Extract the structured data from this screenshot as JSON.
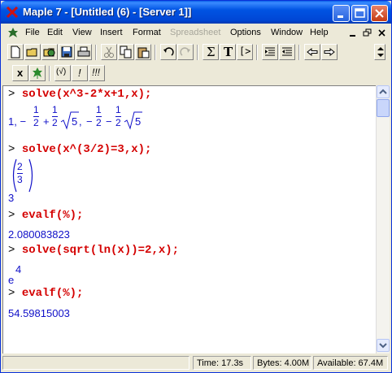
{
  "window": {
    "title": "Maple 7  - [Untitled (6) - [Server 1]]"
  },
  "menu": {
    "items": [
      {
        "label": "File",
        "enabled": true
      },
      {
        "label": "Edit",
        "enabled": true
      },
      {
        "label": "View",
        "enabled": true
      },
      {
        "label": "Insert",
        "enabled": true
      },
      {
        "label": "Format",
        "enabled": true
      },
      {
        "label": "Spreadsheet",
        "enabled": false
      },
      {
        "label": "Options",
        "enabled": true
      },
      {
        "label": "Window",
        "enabled": true
      },
      {
        "label": "Help",
        "enabled": true
      }
    ]
  },
  "toolbar": {
    "text_mode_label": "T",
    "sum_label": "Σ",
    "exec_label": "[>",
    "toggle_x_label": "x",
    "eval_label": "(√)",
    "bang_label": "!",
    "bangs_label": "!!!"
  },
  "worksheet": {
    "prompt": ">",
    "cmd1": "solve(x^3-2*x+1,x);",
    "out1_lead": "1, −",
    "out1_comma": ",",
    "out1_sqrt": "5",
    "frac_num": "1",
    "frac_den": "2",
    "op_plus": "+",
    "op_minus": "−",
    "cmd2": "solve(x^(3/2)=3,x);",
    "out2_num": "2",
    "out2_den": "3",
    "out2_base": "3",
    "cmd3": "evalf(%);",
    "out3": "2.080083823",
    "cmd4": "solve(sqrt(ln(x))=2,x);",
    "out4_base": "e",
    "out4_exp": "4",
    "cmd5": "evalf(%);",
    "out5": "54.59815003"
  },
  "status": {
    "time": "Time: 17.3s",
    "bytes": "Bytes: 4.00M",
    "available": "Available: 67.4M"
  },
  "colors": {
    "command": "#d40000",
    "output": "#1010c8",
    "titlebar": "#0054e3"
  }
}
